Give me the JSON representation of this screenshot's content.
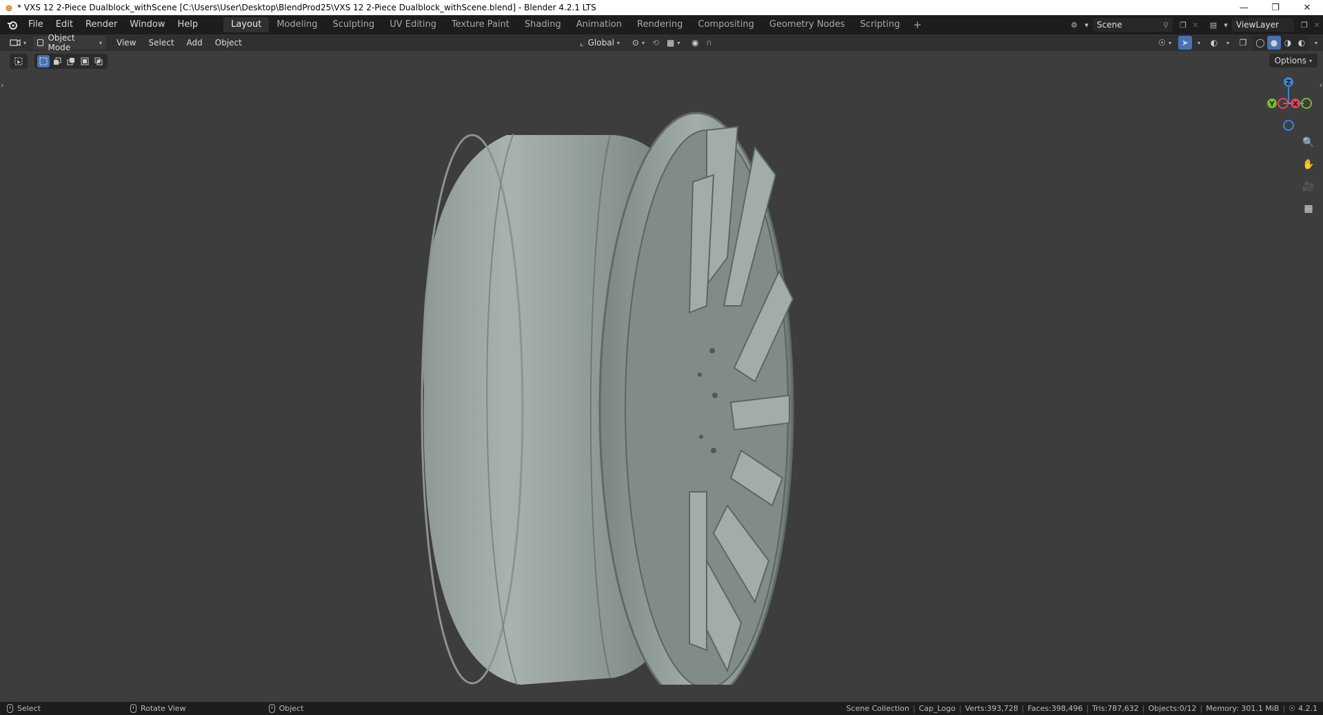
{
  "window": {
    "title": "* VXS 12 2-Piece Dualblock_withScene [C:\\Users\\User\\Desktop\\BlendProd25\\VXS 12 2-Piece Dualblock_withScene.blend] - Blender 4.2.1 LTS",
    "controls": [
      "minimize-icon",
      "restore-icon",
      "close-icon"
    ]
  },
  "menu": {
    "items": [
      "File",
      "Edit",
      "Render",
      "Window",
      "Help"
    ]
  },
  "workspaces": {
    "tabs": [
      "Layout",
      "Modeling",
      "Sculpting",
      "UV Editing",
      "Texture Paint",
      "Shading",
      "Animation",
      "Rendering",
      "Compositing",
      "Geometry Nodes",
      "Scripting"
    ],
    "active": "Layout",
    "add": "+"
  },
  "scene": {
    "name": "Scene",
    "view_layer": "ViewLayer"
  },
  "viewport_header": {
    "mode": "Object Mode",
    "menus": [
      "View",
      "Select",
      "Add",
      "Object"
    ],
    "transform_orientation": "Global"
  },
  "viewport": {
    "options_label": "Options",
    "gizmo": {
      "z": "Z",
      "y": "Y",
      "x": "X"
    },
    "colors": {
      "x_axis": "#e0445a",
      "y_axis": "#7ab929",
      "z_axis": "#3a86d9",
      "active": "#4772b3",
      "background": "#3d3d3d",
      "wheel": "#9aa5a2"
    }
  },
  "status": {
    "hints": [
      {
        "label": "Select"
      },
      {
        "label": "Rotate View"
      },
      {
        "label": "Object"
      }
    ],
    "collection": "Scene Collection",
    "object": "Cap_Logo",
    "verts": "Verts:393,728",
    "faces": "Faces:398,496",
    "tris": "Tris:787,632",
    "objects": "Objects:0/12",
    "memory": "Memory: 301.1 MiB",
    "version": "4.2.1"
  }
}
